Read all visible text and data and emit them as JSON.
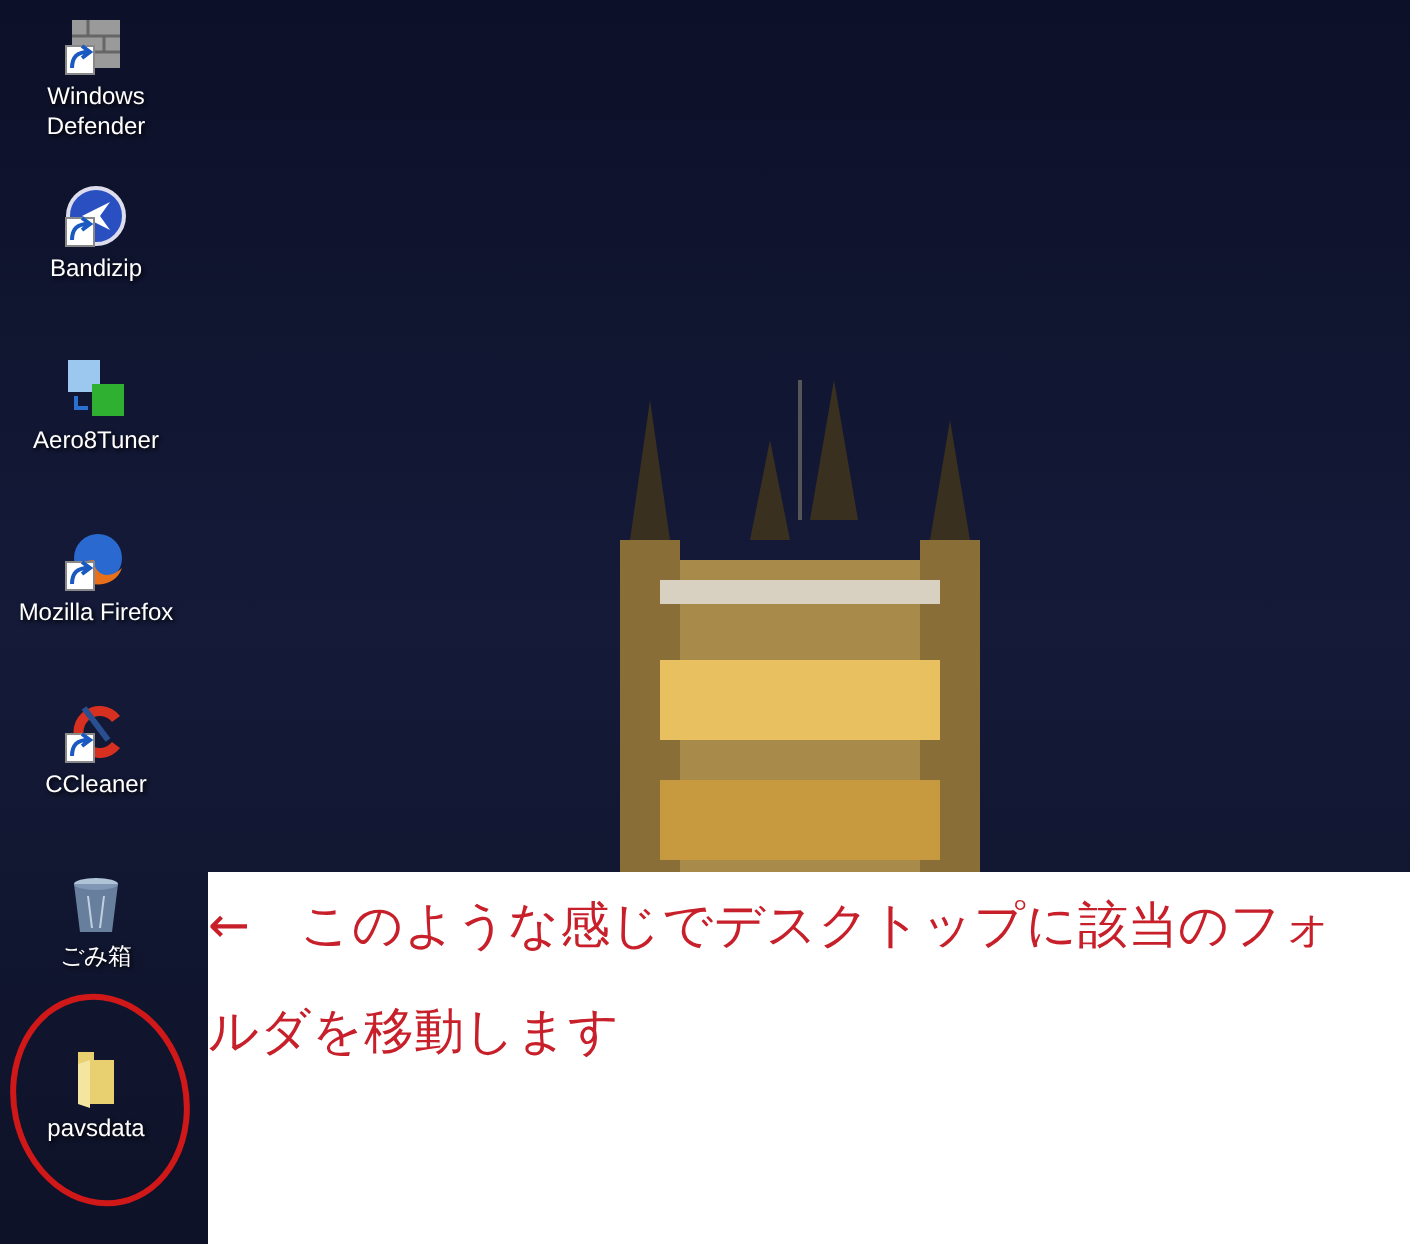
{
  "desktop_icons": [
    {
      "label": "Windows Defender",
      "kind": "wall",
      "shortcut": true
    },
    {
      "label": "Bandizip",
      "kind": "zip",
      "shortcut": true
    },
    {
      "label": "Aero8Tuner",
      "kind": "tuner",
      "shortcut": false
    },
    {
      "label": "Mozilla Firefox",
      "kind": "browser",
      "shortcut": true
    },
    {
      "label": "CCleaner",
      "kind": "cleaner",
      "shortcut": true
    },
    {
      "label": "ごみ箱",
      "kind": "trash",
      "shortcut": false
    },
    {
      "label": "pavsdata",
      "kind": "folder",
      "shortcut": false
    }
  ],
  "annotation": {
    "text": "←　このような感じでデスクトップに該当のフォルダを移動します"
  }
}
